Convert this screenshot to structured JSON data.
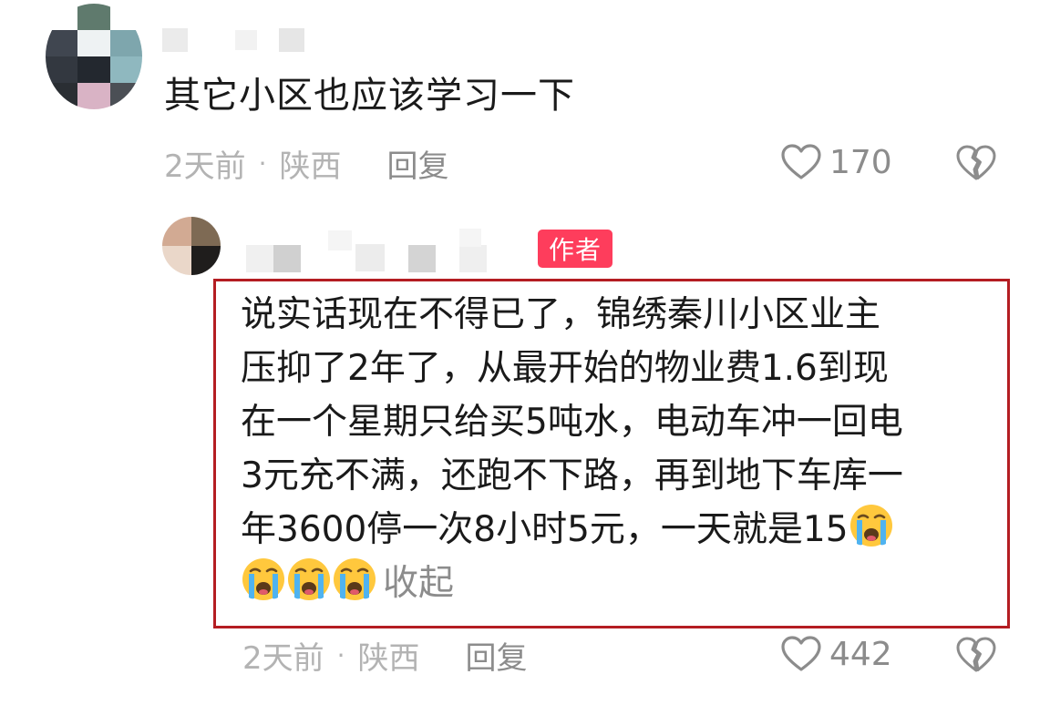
{
  "comment1": {
    "text": "其它小区也应该学习一下",
    "time": "2天前",
    "location": "陕西",
    "reply_label": "回复",
    "likes": "170",
    "icons": [
      "heart-outline-icon",
      "broken-heart-icon"
    ]
  },
  "comment2": {
    "badge": "作者",
    "lines": [
      "说实话现在不得已了，锦绣秦川小区业主",
      "压抑了2年了，从最开始的物业费1.6到现",
      "在一个星期只给买5吨水，电动车冲一回电",
      "3元充不满，还跑不下路，再到地下车库一",
      "年3600停一次8小时5元，一天就是15"
    ],
    "collapse_label": "收起",
    "emoji": "loudly-crying-face",
    "time": "2天前",
    "location": "陕西",
    "reply_label": "回复",
    "likes": "442",
    "icons": [
      "heart-outline-icon",
      "broken-heart-icon"
    ]
  },
  "colors": {
    "author_badge": "#fe3d5c",
    "highlight_border": "#b41d22",
    "meta_text": "#b3b3b3"
  }
}
